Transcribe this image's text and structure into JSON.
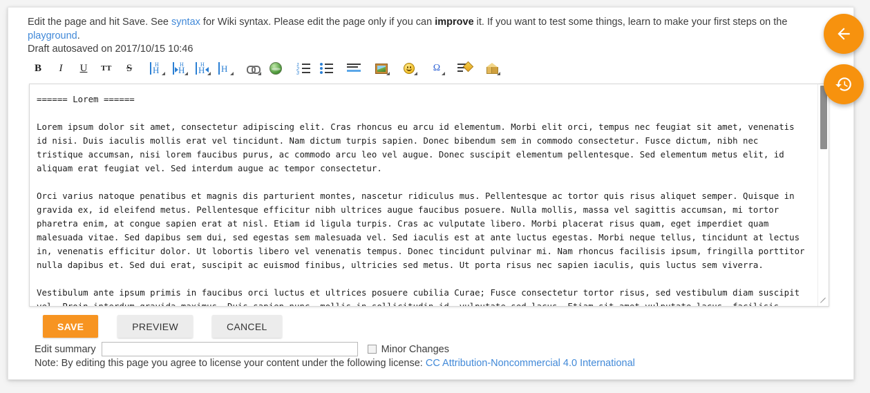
{
  "intro": {
    "part1": "Edit the page and hit Save. See ",
    "link_syntax": "syntax",
    "part2": " for Wiki syntax. Please edit the page only if you can ",
    "emphasis": "improve",
    "part3": " it. If you want to test some things, learn to make your first steps on the ",
    "link_playground": "playground",
    "part4": "."
  },
  "draft": {
    "text": "Draft autosaved on 2017/10/15 10:46"
  },
  "toolbar": {
    "items": [
      {
        "name": "bold-icon",
        "label": "B",
        "title": "Bold Text"
      },
      {
        "name": "italic-icon",
        "label": "I",
        "title": "Italic Text"
      },
      {
        "name": "underline-icon",
        "label": "U",
        "title": "Underlined Text"
      },
      {
        "name": "monospace-icon",
        "label": "TT",
        "title": "Monospaced Text"
      },
      {
        "name": "strikethrough-icon",
        "label": "S",
        "title": "Strike-through Text"
      },
      {
        "name": "same-level-headline-icon",
        "label": "H",
        "title": "Same Level Headline"
      },
      {
        "name": "lower-headline-icon",
        "label": "H",
        "title": "Lower Headline"
      },
      {
        "name": "higher-headline-icon",
        "label": "H",
        "title": "Higher Headline"
      },
      {
        "name": "select-headline-icon",
        "label": "H",
        "title": "Select Headline"
      },
      {
        "name": "internal-link-icon",
        "label": "",
        "title": "Internal Link"
      },
      {
        "name": "external-link-icon",
        "label": "",
        "title": "External Link"
      },
      {
        "name": "ordered-list-icon",
        "label": "",
        "title": "Ordered List Item"
      },
      {
        "name": "unordered-list-icon",
        "label": "",
        "title": "Unordered List Item"
      },
      {
        "name": "horizontal-rule-icon",
        "label": "",
        "title": "Horizontal Rule"
      },
      {
        "name": "image-icon",
        "label": "",
        "title": "Add Images and other files"
      },
      {
        "name": "smiley-icon",
        "label": "",
        "title": "Smileys"
      },
      {
        "name": "special-chars-icon",
        "label": "Ω",
        "title": "Special Characters"
      },
      {
        "name": "signature-icon",
        "label": "",
        "title": "Insert Signature"
      },
      {
        "name": "media-icon",
        "label": "",
        "title": "Media Files"
      }
    ]
  },
  "editor": {
    "content": "====== Lorem ======\n\nLorem ipsum dolor sit amet, consectetur adipiscing elit. Cras rhoncus eu arcu id elementum. Morbi elit orci, tempus nec feugiat sit amet, venenatis id nisi. Duis iaculis mollis erat vel tincidunt. Nam dictum turpis sapien. Donec bibendum sem in commodo consectetur. Fusce dictum, nibh nec tristique accumsan, nisi lorem faucibus purus, ac commodo arcu leo vel augue. Donec suscipit elementum pellentesque. Sed elementum metus elit, id aliquam erat feugiat vel. Sed interdum augue ac tempor consectetur.\n\nOrci varius natoque penatibus et magnis dis parturient montes, nascetur ridiculus mus. Pellentesque ac tortor quis risus aliquet semper. Quisque in gravida ex, id eleifend metus. Pellentesque efficitur nibh ultrices augue faucibus posuere. Nulla mollis, massa vel sagittis accumsan, mi tortor pharetra enim, at congue sapien erat at nisl. Etiam id ligula turpis. Cras ac vulputate libero. Morbi placerat risus quam, eget imperdiet quam malesuada vitae. Sed dapibus sem dui, sed egestas sem malesuada vel. Sed iaculis est at ante luctus egestas. Morbi neque tellus, tincidunt at lectus in, venenatis efficitur dolor. Ut lobortis libero vel venenatis tempus. Donec tincidunt pulvinar mi. Nam rhoncus facilisis ipsum, fringilla porttitor nulla dapibus et. Sed dui erat, suscipit ac euismod finibus, ultricies sed metus. Ut porta risus nec sapien iaculis, quis luctus sem viverra.\n\nVestibulum ante ipsum primis in faucibus orci luctus et ultrices posuere cubilia Curae; Fusce consectetur tortor risus, sed vestibulum diam suscipit vel. Proin interdum gravida maximus. Duis sapien nunc, mollis in sollicitudin id, vulputate sed lacus. Etiam sit amet vulputate lacus, facilisis euismod enim. Quisque congue nibh risus."
  },
  "buttons": {
    "save": "SAVE",
    "preview": "PREVIEW",
    "cancel": "CANCEL"
  },
  "summary": {
    "label": "Edit summary",
    "value": "",
    "placeholder": "",
    "minor_label": "Minor Changes",
    "minor_checked": false
  },
  "note": {
    "text": "Note: By editing this page you agree to license your content under the following license: ",
    "license_link": "CC Attribution-Noncommercial 4.0 International"
  },
  "fabs": [
    {
      "name": "back-fab",
      "icon": "arrow-left-icon",
      "title": "Back to top"
    },
    {
      "name": "history-fab",
      "icon": "history-icon",
      "title": "Old revisions"
    }
  ],
  "colors": {
    "accent": "#f7920e",
    "save_button": "#f79421",
    "link": "#4189d8",
    "heading_icon": "#2a7fd4"
  }
}
